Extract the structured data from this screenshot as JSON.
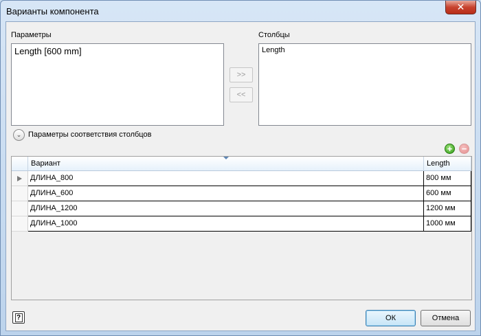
{
  "window": {
    "title": "Варианты компонента",
    "close_glyph": "✕"
  },
  "parameters": {
    "label": "Параметры",
    "items": [
      "Length [600 mm]"
    ]
  },
  "columns": {
    "label": "Столбцы",
    "items": [
      "Length"
    ]
  },
  "transfer": {
    "add_label": ">>",
    "remove_label": "<<"
  },
  "expander": {
    "label": "Параметры соответствия столбцов"
  },
  "row_actions": {
    "add_glyph": "+",
    "remove_glyph": "−"
  },
  "grid": {
    "headers": [
      "Вариант",
      "Length"
    ],
    "rows": [
      [
        "ДЛИНА_800",
        "800 мм"
      ],
      [
        "ДЛИНА_600",
        "600 мм"
      ],
      [
        "ДЛИНА_1200",
        "1200 мм"
      ],
      [
        "ДЛИНА_1000",
        "1000 мм"
      ]
    ]
  },
  "footer": {
    "help_glyph": "?",
    "ok_label": "ОК",
    "cancel_label": "Отмена"
  }
}
